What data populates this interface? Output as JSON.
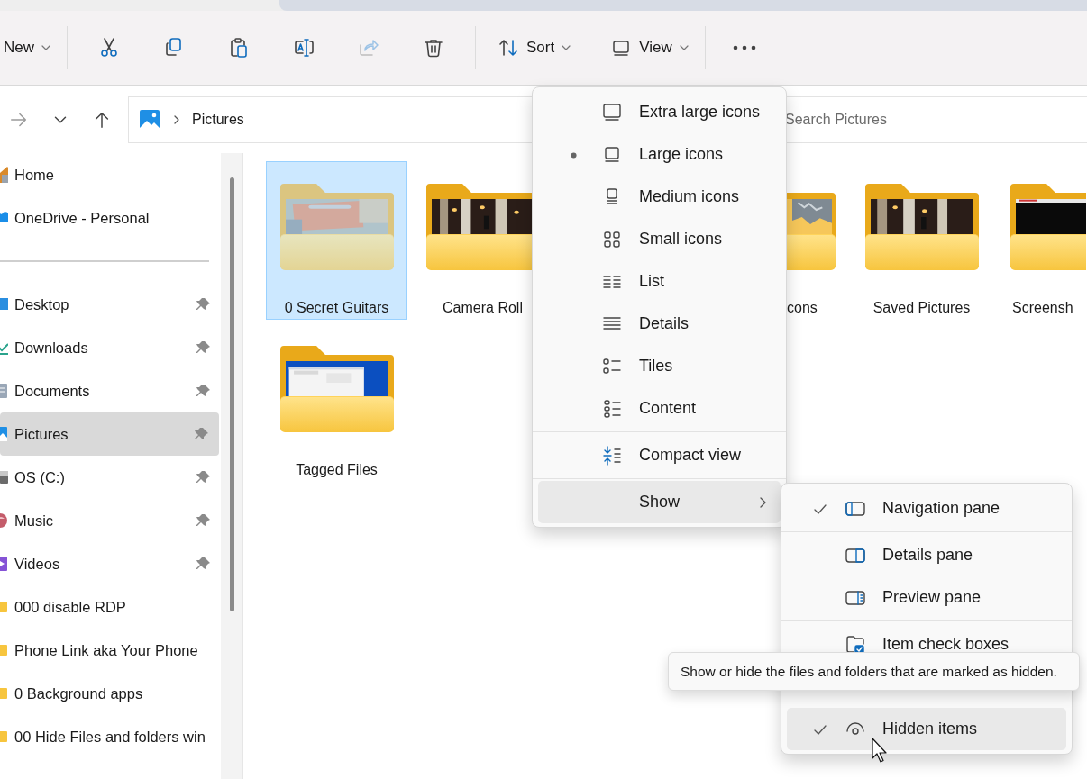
{
  "toolbar": {
    "new": {
      "label": "New"
    },
    "actions": [
      {
        "kind": "cut",
        "disabled": false
      },
      {
        "kind": "copy",
        "disabled": false
      },
      {
        "kind": "paste",
        "disabled": false
      },
      {
        "kind": "rename",
        "disabled": false
      },
      {
        "kind": "share",
        "disabled": true
      },
      {
        "kind": "delete",
        "disabled": false
      }
    ],
    "sort": {
      "label": "Sort"
    },
    "view": {
      "label": "View"
    }
  },
  "navigation": [
    {
      "kind": "forward",
      "disabled": true
    },
    {
      "kind": "recent",
      "disabled": false
    },
    {
      "kind": "up",
      "disabled": false
    }
  ],
  "address": {
    "path": [
      "Pictures"
    ]
  },
  "search": {
    "placeholder": "Search Pictures"
  },
  "sidebar": {
    "items": [
      {
        "kind": "home",
        "label": "Home",
        "pinned": false,
        "selected": false
      },
      {
        "kind": "cloud",
        "label": "OneDrive - Personal",
        "pinned": false,
        "selected": false
      },
      {
        "kind": "divider"
      },
      {
        "kind": "desktop",
        "label": "Desktop",
        "pinned": true,
        "selected": false
      },
      {
        "kind": "download",
        "label": "Downloads",
        "pinned": true,
        "selected": false
      },
      {
        "kind": "document",
        "label": "Documents",
        "pinned": true,
        "selected": false
      },
      {
        "kind": "pictures",
        "label": "Pictures",
        "pinned": true,
        "selected": true
      },
      {
        "kind": "drive",
        "label": "OS (C:)",
        "pinned": true,
        "selected": false
      },
      {
        "kind": "music",
        "label": "Music",
        "pinned": true,
        "selected": false
      },
      {
        "kind": "videos",
        "label": "Videos",
        "pinned": true,
        "selected": false
      },
      {
        "kind": "folder",
        "label": "000 disable RDP",
        "pinned": false,
        "selected": false
      },
      {
        "kind": "folder",
        "label": "Phone Link aka Your Phone",
        "pinned": false,
        "selected": false
      },
      {
        "kind": "folder",
        "label": "0 Background apps",
        "pinned": false,
        "selected": false
      },
      {
        "kind": "folder",
        "label": "00 Hide Files and folders win",
        "pinned": false,
        "selected": false
      }
    ]
  },
  "folders": [
    {
      "label": "0 Secret Guitars",
      "selected": true
    },
    {
      "label": "Camera Roll",
      "selected": false
    },
    {
      "label": "cons",
      "selected": false,
      "cut_start": true
    },
    {
      "label": "Saved Pictures",
      "selected": false
    },
    {
      "label": "Screensh",
      "selected": false,
      "cut_end": true
    },
    {
      "label": "Tagged Files",
      "selected": false
    }
  ],
  "view_menu": {
    "items": [
      {
        "kind": "xl",
        "label": "Extra large icons",
        "selected": false
      },
      {
        "kind": "large",
        "label": "Large icons",
        "selected": true
      },
      {
        "kind": "medium",
        "label": "Medium icons",
        "selected": false
      },
      {
        "kind": "small",
        "label": "Small icons",
        "selected": false
      },
      {
        "kind": "list",
        "label": "List",
        "selected": false
      },
      {
        "kind": "details",
        "label": "Details",
        "selected": false
      },
      {
        "kind": "tiles",
        "label": "Tiles",
        "selected": false
      },
      {
        "kind": "content",
        "label": "Content",
        "selected": false
      },
      {
        "kind": "compact",
        "label": "Compact view",
        "checked": false
      },
      {
        "kind": "submenu",
        "label": "Show",
        "expanded": true
      }
    ]
  },
  "show_menu": {
    "items": [
      {
        "kind": "navpane",
        "label": "Navigation pane",
        "checked": true,
        "hovered": false
      },
      {
        "kind": "detailspane",
        "label": "Details pane",
        "checked": false,
        "hovered": false
      },
      {
        "kind": "previewpane",
        "label": "Preview pane",
        "checked": false,
        "hovered": false
      },
      {
        "kind": "checkboxes",
        "label": "Item check boxes",
        "checked": false,
        "hovered": false
      },
      {
        "kind": "hidden",
        "label": "Hidden items",
        "checked": true,
        "hovered": true
      }
    ]
  },
  "tooltip": {
    "text": "Show or hide the files and folders that are marked as hidden."
  }
}
